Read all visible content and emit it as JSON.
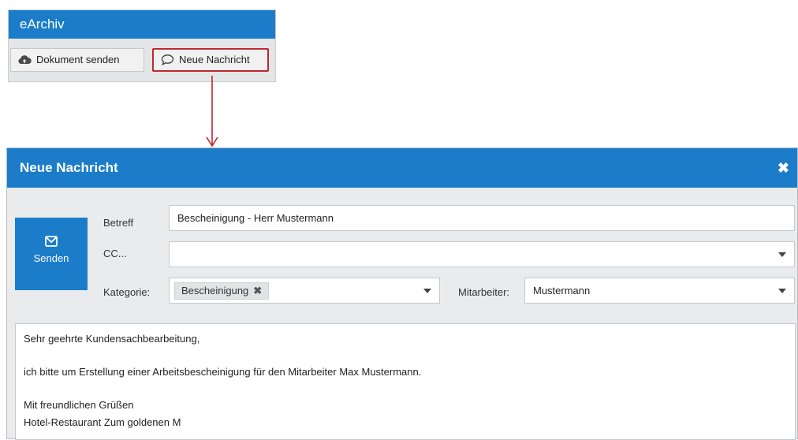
{
  "earchiv": {
    "title": "eArchiv",
    "toolbar": {
      "send_document_label": "Dokument senden",
      "new_message_label": "Neue Nachricht"
    }
  },
  "dialog": {
    "title": "Neue Nachricht",
    "close_icon": "close-icon",
    "send_label": "Senden",
    "fields": {
      "subject_label": "Betreff",
      "subject_value": "Bescheinigung - Herr Mustermann",
      "cc_label": "CC...",
      "cc_value": "",
      "category_label": "Kategorie:",
      "category_tag": "Bescheinigung",
      "employee_label": "Mitarbeiter:",
      "employee_value": "Mustermann"
    },
    "body": {
      "greeting": "Sehr geehrte Kundensachbearbeitung,",
      "text": "ich bitte um Erstellung einer Arbeitsbescheinigung für den Mitarbeiter Max Mustermann.",
      "closing": "Mit freundlichen Grüßen",
      "signature": "Hotel-Restaurant Zum goldenen M"
    }
  },
  "colors": {
    "brand_blue": "#1b7dc9",
    "highlight_red": "#c0272d"
  }
}
